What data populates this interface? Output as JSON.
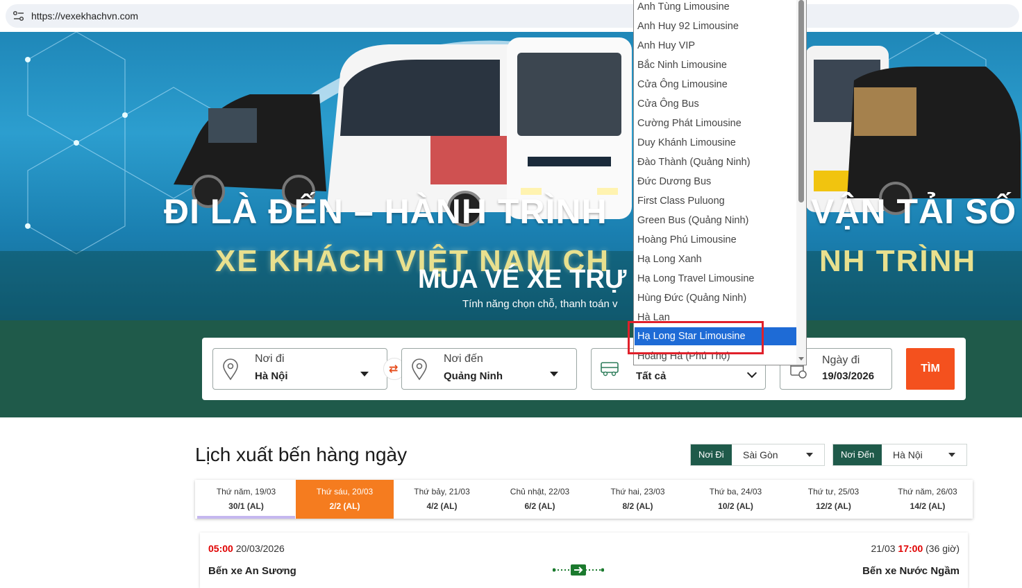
{
  "browser": {
    "url": "https://vexekhachvn.com",
    "site_icon": "site-settings-icon"
  },
  "hero": {
    "slogan": "ĐI LÀ ĐẾN – HÀNH TRÌNH",
    "slogan_right": "VẬN TẢI SỐ",
    "subslogan": "XE KHÁCH VIỆT NAM CH",
    "subslogan_right": "NH TRÌNH",
    "title": "MUA VÉ XE TRỰ",
    "subtitle": "Tính năng chọn chỗ, thanh toán v"
  },
  "search": {
    "from": {
      "label": "Nơi đi",
      "value": "Hà Nội",
      "icon": "location-pin-icon"
    },
    "to": {
      "label": "Nơi đến",
      "value": "Quảng Ninh",
      "icon": "location-pin-icon"
    },
    "swap_icon": "swap-arrows-icon",
    "operator": {
      "value": "Tất cả",
      "icon": "bus-icon"
    },
    "date": {
      "label": "Ngày đi",
      "value": "19/03/2026",
      "icon": "calendar-icon"
    },
    "find_label": "TÌM"
  },
  "dropdown": {
    "options": [
      "Anh Tùng Limousine",
      "Anh Huy 92 Limousine",
      "Anh Huy VIP",
      "Bắc Ninh Limousine",
      "Cửa Ông Limousine",
      "Cửa Ông Bus",
      "Cường Phát Limousine",
      "Duy Khánh Limousine",
      "Đào Thành (Quảng Ninh)",
      "Đức Dương Bus",
      "First Class Puluong",
      "Green Bus (Quảng Ninh)",
      "Hoàng Phú Limousine",
      "Hạ Long Xanh",
      "Hạ Long Travel Limousine",
      "Hùng Đức (Quảng Ninh)",
      "Hà Lan",
      "Hạ Long Star Limousine",
      "Hoàng Hà (Phú Thọ)"
    ],
    "selected": "Hạ Long Star Limousine"
  },
  "schedule": {
    "title": "Lịch xuất bến hàng ngày",
    "from_tag": "Nơi Đi",
    "from_value": "Sài Gòn",
    "to_tag": "Nơi Đến",
    "to_value": "Hà Nội",
    "days": [
      {
        "label": "Thứ năm, 19/03",
        "lunar": "30/1 (AL)"
      },
      {
        "label": "Thứ sáu, 20/03",
        "lunar": "2/2 (AL)"
      },
      {
        "label": "Thứ bảy, 21/03",
        "lunar": "4/2 (AL)"
      },
      {
        "label": "Chủ nhật, 22/03",
        "lunar": "6/2 (AL)"
      },
      {
        "label": "Thứ hai, 23/03",
        "lunar": "8/2 (AL)"
      },
      {
        "label": "Thứ ba, 24/03",
        "lunar": "10/2 (AL)"
      },
      {
        "label": "Thứ tư, 25/03",
        "lunar": "12/2 (AL)"
      },
      {
        "label": "Thứ năm, 26/03",
        "lunar": "14/2 (AL)"
      }
    ],
    "active_day": "Thứ sáu, 20/03",
    "trip": {
      "depart_time": "05:00",
      "depart_date": "20/03/2026",
      "arrive_date": "21/03",
      "arrive_time": "17:00",
      "duration": "(36 giờ)",
      "from_station": "Bến xe An Sương",
      "to_station": "Bến xe Nước Ngầm",
      "route_icon": "route-arrow-icon"
    }
  },
  "colors": {
    "brand_green": "#1f5a4a",
    "accent_orange": "#f4511e",
    "day_active": "#f57c1f",
    "select_blue": "#1e6bd6",
    "highlight_red": "#e0202a"
  }
}
